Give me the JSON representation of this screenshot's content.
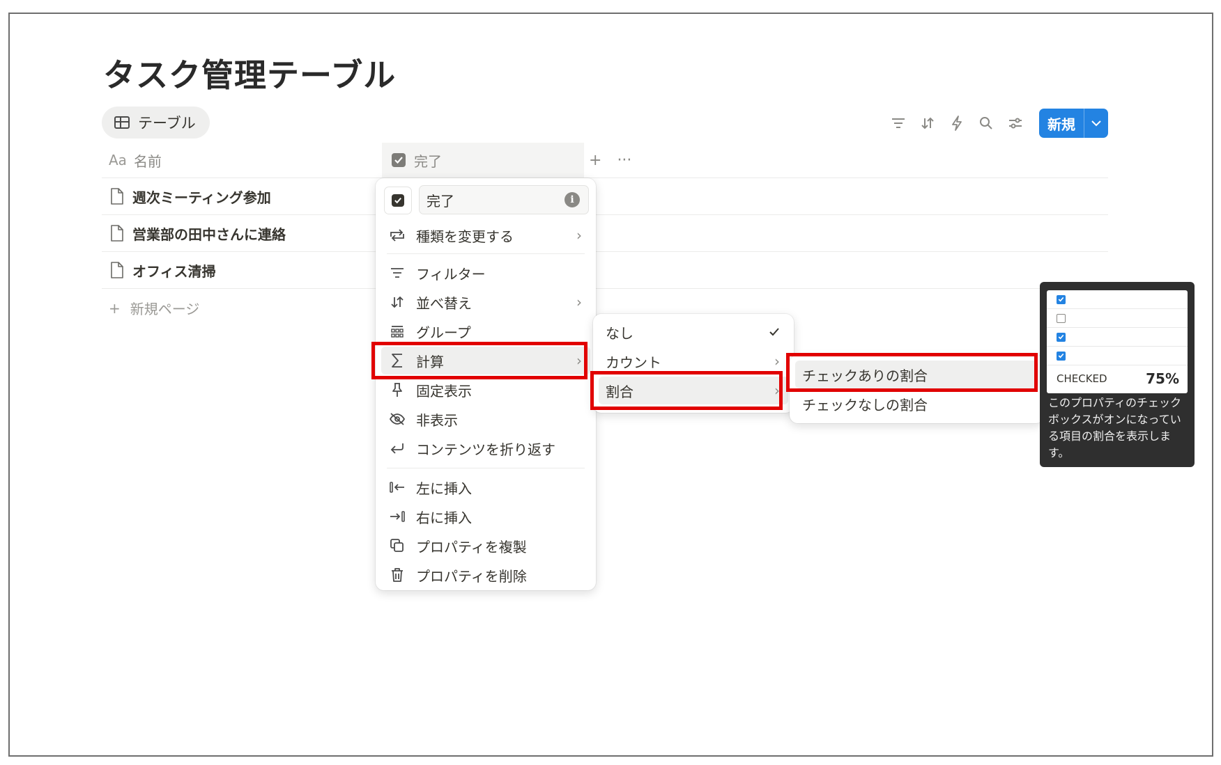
{
  "page": {
    "title": "タスク管理テーブル"
  },
  "view_tab": {
    "label": "テーブル",
    "icon": "table-icon"
  },
  "toolbar": {
    "icons": [
      "filter-icon",
      "sort-icon",
      "automation-icon",
      "search-icon",
      "settings-icon"
    ],
    "new_label": "新規",
    "accent": "#2383e2"
  },
  "columns": {
    "name_prefix": "Aa",
    "name": "名前",
    "done": "完了",
    "add_symbol": "+",
    "more_symbol": "···"
  },
  "rows": [
    {
      "title": "週次ミーティング参加"
    },
    {
      "title": "営業部の田中さんに連絡"
    },
    {
      "title": "オフィス清掃"
    }
  ],
  "new_page": {
    "symbol": "+",
    "label": "新規ページ"
  },
  "property_menu": {
    "name_value": "完了",
    "items": [
      {
        "label": "種類を変更する",
        "icon": "change-type-icon",
        "submenu": true
      },
      {
        "label": "フィルター",
        "icon": "filter-icon",
        "submenu": false
      },
      {
        "label": "並べ替え",
        "icon": "sort-icon",
        "submenu": true
      },
      {
        "label": "グループ",
        "icon": "group-icon",
        "submenu": false
      },
      {
        "label": "計算",
        "icon": "sigma-icon",
        "submenu": true,
        "highlighted": true
      },
      {
        "label": "固定表示",
        "icon": "pin-icon",
        "submenu": false
      },
      {
        "label": "非表示",
        "icon": "eye-off-icon",
        "submenu": false
      },
      {
        "label": "コンテンツを折り返す",
        "icon": "wrap-icon",
        "submenu": false
      },
      {
        "label": "左に挿入",
        "icon": "insert-left-icon",
        "submenu": false
      },
      {
        "label": "右に挿入",
        "icon": "insert-right-icon",
        "submenu": false
      },
      {
        "label": "プロパティを複製",
        "icon": "duplicate-icon",
        "submenu": false
      },
      {
        "label": "プロパティを削除",
        "icon": "trash-icon",
        "submenu": false
      }
    ]
  },
  "calc_menu": {
    "items": [
      {
        "label": "なし",
        "checked": true
      },
      {
        "label": "カウント",
        "submenu": true
      },
      {
        "label": "割合",
        "submenu": true,
        "highlighted": true
      }
    ]
  },
  "ratio_menu": {
    "items": [
      {
        "label": "チェックありの割合",
        "highlighted": true
      },
      {
        "label": "チェックなしの割合"
      }
    ]
  },
  "tooltip": {
    "preview_checks": [
      true,
      false,
      true,
      true
    ],
    "stat_label": "CHECKED",
    "stat_value": "75%",
    "description": "このプロパティのチェックボックスがオンになっている項目の割合を表示します。"
  },
  "colors": {
    "highlight_box": "#e10000",
    "tooltip_bg": "#2f2f2f"
  }
}
